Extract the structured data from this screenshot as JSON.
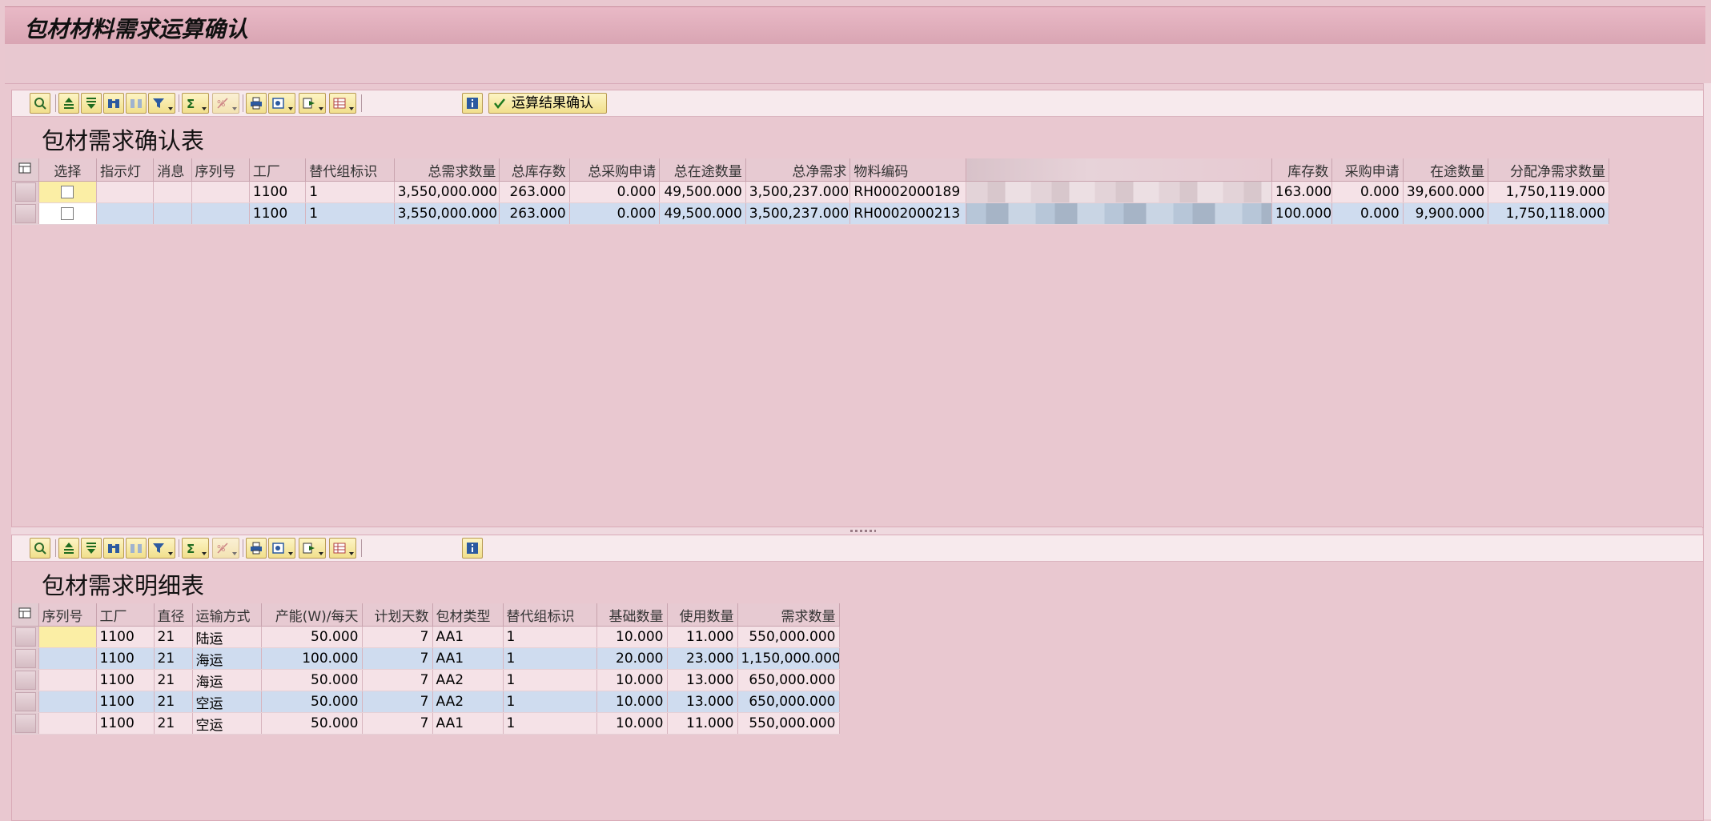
{
  "window": {
    "title": "包材材料需求运算确认"
  },
  "top_toolbar": {
    "confirm_button_label": "运算结果确认"
  },
  "top_grid": {
    "title": "包材需求确认表",
    "columns": [
      "选择",
      "指示灯",
      "消息",
      "序列号",
      "工厂",
      "替代组标识",
      "总需求数量",
      "总库存数",
      "总采购申请",
      "总在途数量",
      "总净需求",
      "物料编码",
      "",
      "库存数",
      "采购申请",
      "在途数量",
      "分配净需求数量"
    ],
    "rows": [
      {
        "select": false,
        "light": "",
        "msg": "",
        "seq": "",
        "plant": "1100",
        "alt_group": "1",
        "total_demand": "3,550,000.000",
        "total_stock": "263.000",
        "total_pr": "0.000",
        "total_transit": "49,500.000",
        "total_net": "3,500,237.000",
        "material": "RH0002000189",
        "stock": "163.000",
        "pr": "0.000",
        "transit": "39,600.000",
        "alloc_net": "1,750,119.000"
      },
      {
        "select": false,
        "light": "",
        "msg": "",
        "seq": "",
        "plant": "1100",
        "alt_group": "1",
        "total_demand": "3,550,000.000",
        "total_stock": "263.000",
        "total_pr": "0.000",
        "total_transit": "49,500.000",
        "total_net": "3,500,237.000",
        "material": "RH0002000213",
        "stock": "100.000",
        "pr": "0.000",
        "transit": "9,900.000",
        "alloc_net": "1,750,118.000"
      }
    ]
  },
  "bottom_grid": {
    "title": "包材需求明细表",
    "columns": [
      "序列号",
      "工厂",
      "直径",
      "运输方式",
      "产能(W)/每天",
      "计划天数",
      "包材类型",
      "替代组标识",
      "基础数量",
      "使用数量",
      "需求数量"
    ],
    "rows": [
      {
        "seq": "",
        "plant": "1100",
        "dia": "21",
        "transport": "陆运",
        "capacity": "50.000",
        "days": "7",
        "pack_type": "AA1",
        "alt_group": "1",
        "base_qty": "10.000",
        "use_qty": "11.000",
        "demand": "550,000.000"
      },
      {
        "seq": "",
        "plant": "1100",
        "dia": "21",
        "transport": "海运",
        "capacity": "100.000",
        "days": "7",
        "pack_type": "AA1",
        "alt_group": "1",
        "base_qty": "20.000",
        "use_qty": "23.000",
        "demand": "1,150,000.000"
      },
      {
        "seq": "",
        "plant": "1100",
        "dia": "21",
        "transport": "海运",
        "capacity": "50.000",
        "days": "7",
        "pack_type": "AA2",
        "alt_group": "1",
        "base_qty": "10.000",
        "use_qty": "13.000",
        "demand": "650,000.000"
      },
      {
        "seq": "",
        "plant": "1100",
        "dia": "21",
        "transport": "空运",
        "capacity": "50.000",
        "days": "7",
        "pack_type": "AA2",
        "alt_group": "1",
        "base_qty": "10.000",
        "use_qty": "13.000",
        "demand": "650,000.000"
      },
      {
        "seq": "",
        "plant": "1100",
        "dia": "21",
        "transport": "空运",
        "capacity": "50.000",
        "days": "7",
        "pack_type": "AA1",
        "alt_group": "1",
        "base_qty": "10.000",
        "use_qty": "11.000",
        "demand": "550,000.000"
      }
    ]
  },
  "icons": [
    "details-icon",
    "sort-ascending-icon",
    "sort-descending-icon",
    "find-icon",
    "find-next-icon",
    "filter-icon",
    "sum-icon",
    "subtotal-icon",
    "print-icon",
    "views-icon",
    "export-icon",
    "layout-icon",
    "info-icon",
    "checkmark-icon",
    "column-settings-icon"
  ],
  "colors": {
    "background": "#e9c8d0",
    "row_pink": "#f5e2e7",
    "row_blue": "#cfdcef",
    "toolbar_button": "#f1df8c",
    "selected_cell": "#fbeea5"
  }
}
